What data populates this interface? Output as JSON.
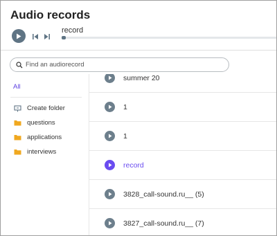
{
  "app": {
    "title": "Audio records"
  },
  "player": {
    "track": "record",
    "progress_fraction": 0.02,
    "icons": {
      "play": "play-icon",
      "previous": "skip-previous-icon",
      "next": "skip-next-icon"
    }
  },
  "search": {
    "placeholder": "Find an audiorecord",
    "value": "",
    "icon": "search-icon"
  },
  "filter": {
    "all_label": "All",
    "active_color": "#5b3fe0"
  },
  "sidebar": {
    "create_folder": {
      "label": "Create folder",
      "icon": "add-folder-icon"
    },
    "folders": [
      {
        "label": "questions",
        "icon": "folder-icon"
      },
      {
        "label": "applications",
        "icon": "folder-icon"
      },
      {
        "label": "interviews",
        "icon": "folder-icon"
      }
    ],
    "folder_color": "#f0a820"
  },
  "records": [
    {
      "name": "summer 20",
      "active": false
    },
    {
      "name": "1",
      "active": false
    },
    {
      "name": "1",
      "active": false
    },
    {
      "name": "record",
      "active": true
    },
    {
      "name": "3828_call-sound.ru__ (5)",
      "active": false
    },
    {
      "name": "3827_call-sound.ru__ (7)",
      "active": false
    }
  ],
  "colors": {
    "accent": "#6a4cf0",
    "play_button": "#6d7f8c"
  }
}
